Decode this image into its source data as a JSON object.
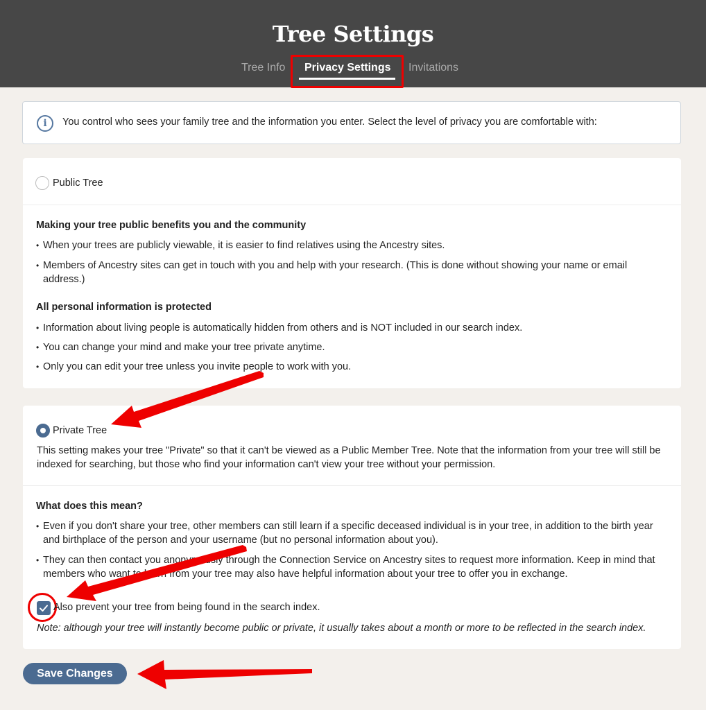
{
  "header": {
    "title": "Tree Settings",
    "tabs": [
      {
        "label": "Tree Info"
      },
      {
        "label": "Privacy Settings",
        "active": true
      },
      {
        "label": "Invitations"
      }
    ]
  },
  "info": {
    "icon": "info-icon",
    "text": "You control who sees your family tree and the information you enter. Select the level of privacy you are comfortable with:"
  },
  "public": {
    "label": "Public Tree",
    "selected": false,
    "heading1": "Making your tree public benefits you and the community",
    "bullets1": [
      "When your trees are publicly viewable, it is easier to find relatives using the Ancestry sites.",
      "Members of Ancestry sites can get in touch with you and help with your research. (This is done without showing your name or email address.)"
    ],
    "heading2": "All personal information is protected",
    "bullets2": [
      "Information about living people is automatically hidden from others and is NOT included in our search index.",
      "You can change your mind and make your tree private anytime.",
      "Only you can edit your tree unless you invite people to work with you."
    ]
  },
  "private": {
    "label": "Private Tree",
    "selected": true,
    "description": "This setting makes your tree \"Private\" so that it can't be viewed as a Public Member Tree. Note that the information from your tree will still be indexed for searching, but those who find your information can't view your tree without your permission.",
    "heading": "What does this mean?",
    "bullets": [
      "Even if you don't share your tree, other members can still learn if a specific deceased individual is in your tree, in addition to the birth year and birthplace of the person and your username (but no personal information about you).",
      "They can then contact you anonymously through the Connection Service on Ancestry sites to request more information. Keep in mind that members who want to learn from your tree may also have helpful information about your tree to offer you in exchange."
    ],
    "checkbox_label": "Also prevent your tree from being found in the search index.",
    "checkbox_checked": true,
    "note": "Note: although your tree will instantly become public or private, it usually takes about a month or more to be reflected in the search index."
  },
  "save_label": "Save Changes",
  "colors": {
    "header_bg": "#474747",
    "accent": "#4b6b91",
    "annotation": "#e00000",
    "page_bg": "#f3f0ec"
  }
}
